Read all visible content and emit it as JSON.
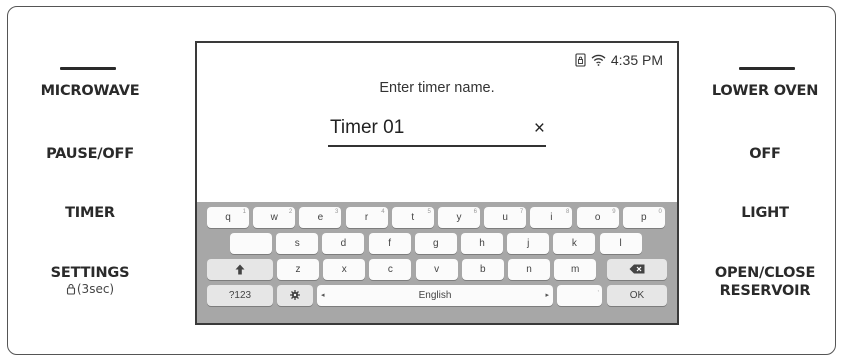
{
  "left_buttons": [
    "MICROWAVE",
    "PAUSE/OFF",
    "TIMER",
    "SETTINGS"
  ],
  "settings_sub": "(3sec)",
  "right_buttons": [
    "LOWER OVEN",
    "OFF",
    "LIGHT",
    "OPEN/CLOSE",
    "RESERVOIR"
  ],
  "screen": {
    "time": "4:35 PM",
    "status_icons": [
      "door-lock-icon",
      "wifi-icon"
    ],
    "prompt": "Enter timer name.",
    "input_value": "Timer 01",
    "clear_symbol": "×"
  },
  "keyboard": {
    "row1": [
      "q",
      "w",
      "e",
      "r",
      "t",
      "y",
      "u",
      "i",
      "o",
      "p"
    ],
    "row1_hints": [
      "1",
      "2",
      "3",
      "4",
      "5",
      "6",
      "7",
      "8",
      "9",
      "0"
    ],
    "row2": [
      "",
      "s",
      "d",
      "f",
      "g",
      "h",
      "j",
      "k",
      "l"
    ],
    "row3": [
      "z",
      "x",
      "c",
      "v",
      "b",
      "n",
      "m"
    ],
    "mode_label": "?123",
    "space_label": "English",
    "ok_label": "OK",
    "space_left_arrow": "◂",
    "space_right_arrow": "▸"
  },
  "colors": {
    "keyboard_bg": "#a7a7a7",
    "key_bg": "#fbfbfb",
    "border": "#3a3a3a",
    "text": "#2a2a2a"
  }
}
